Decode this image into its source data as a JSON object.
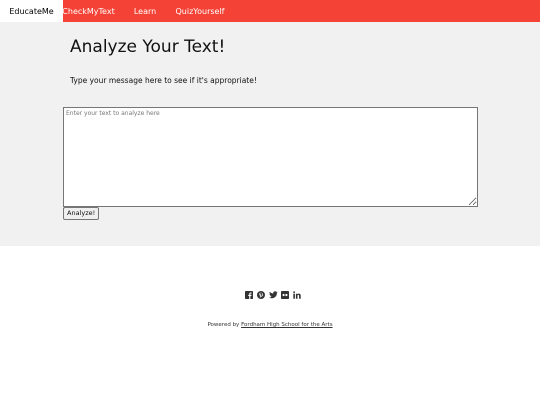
{
  "nav": {
    "brand": "EducateMe",
    "items": [
      {
        "label": "CheckMyText"
      },
      {
        "label": "Learn"
      },
      {
        "label": "QuizYourself"
      }
    ]
  },
  "main": {
    "title": "Analyze Your Text!",
    "subtitle": "Type your message here to see if it's appropriate!",
    "textarea": {
      "placeholder": "Enter your text to analyze here",
      "value": ""
    },
    "button_label": "Analyze!"
  },
  "footer": {
    "social_icons": [
      "facebook-icon",
      "pinterest-icon",
      "twitter-icon",
      "flickr-icon",
      "linkedin-icon"
    ],
    "powered_prefix": "Powered by ",
    "powered_link": "Fordham High School for the Arts"
  },
  "colors": {
    "nav_background": "#f44336",
    "content_background": "#f1f1f1"
  }
}
